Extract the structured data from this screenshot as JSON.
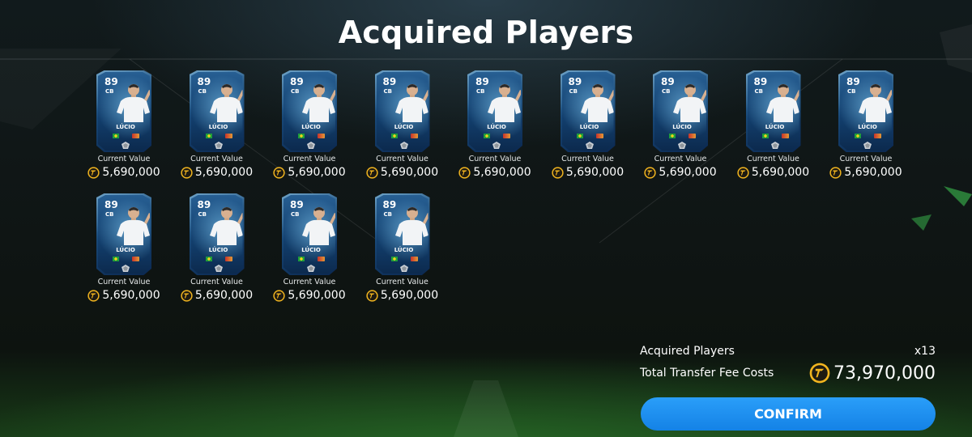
{
  "title": "Acquired Players",
  "players": [
    {
      "rating": "89",
      "position": "CB",
      "name": "LÚCIO",
      "value_label": "Current Value",
      "value": "5,690,000"
    },
    {
      "rating": "89",
      "position": "CB",
      "name": "LÚCIO",
      "value_label": "Current Value",
      "value": "5,690,000"
    },
    {
      "rating": "89",
      "position": "CB",
      "name": "LÚCIO",
      "value_label": "Current Value",
      "value": "5,690,000"
    },
    {
      "rating": "89",
      "position": "CB",
      "name": "LÚCIO",
      "value_label": "Current Value",
      "value": "5,690,000"
    },
    {
      "rating": "89",
      "position": "CB",
      "name": "LÚCIO",
      "value_label": "Current Value",
      "value": "5,690,000"
    },
    {
      "rating": "89",
      "position": "CB",
      "name": "LÚCIO",
      "value_label": "Current Value",
      "value": "5,690,000"
    },
    {
      "rating": "89",
      "position": "CB",
      "name": "LÚCIO",
      "value_label": "Current Value",
      "value": "5,690,000"
    },
    {
      "rating": "89",
      "position": "CB",
      "name": "LÚCIO",
      "value_label": "Current Value",
      "value": "5,690,000"
    },
    {
      "rating": "89",
      "position": "CB",
      "name": "LÚCIO",
      "value_label": "Current Value",
      "value": "5,690,000"
    },
    {
      "rating": "89",
      "position": "CB",
      "name": "LÚCIO",
      "value_label": "Current Value",
      "value": "5,690,000"
    },
    {
      "rating": "89",
      "position": "CB",
      "name": "LÚCIO",
      "value_label": "Current Value",
      "value": "5,690,000"
    },
    {
      "rating": "89",
      "position": "CB",
      "name": "LÚCIO",
      "value_label": "Current Value",
      "value": "5,690,000"
    },
    {
      "rating": "89",
      "position": "CB",
      "name": "LÚCIO",
      "value_label": "Current Value",
      "value": "5,690,000"
    }
  ],
  "summary": {
    "acquired_label": "Acquired Players",
    "acquired_count": "x13",
    "fee_label": "Total Transfer Fee Costs",
    "fee_value": "73,970,000"
  },
  "confirm_label": "CONFIRM",
  "icons": {
    "coin": "fc-coin-icon",
    "flag": "brazil-flag-icon",
    "club": "club-badge-icon",
    "rarity": "rarity-badge-icon"
  },
  "colors": {
    "accent": "#1e8ff0",
    "coin": "#f2b51f",
    "card": "#1a4c7c",
    "pitch": "#2f7a1f"
  }
}
